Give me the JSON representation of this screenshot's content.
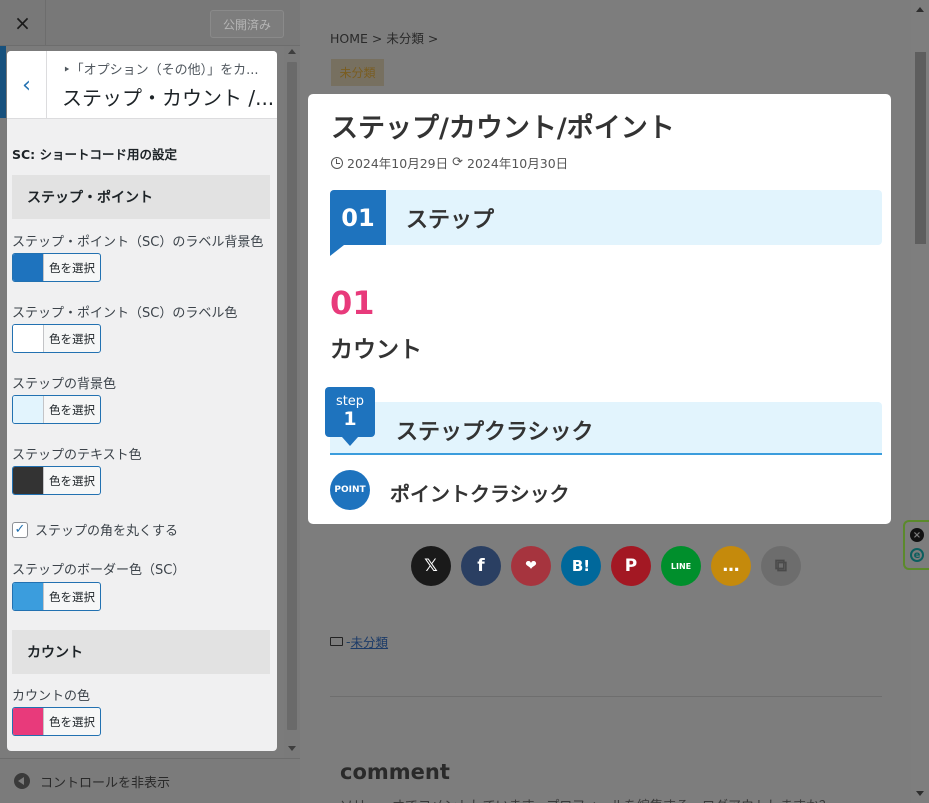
{
  "topbar": {
    "close_icon": "×",
    "publish_label": "公開済み"
  },
  "panel": {
    "back_icon": "‹",
    "breadcrumb": "‣「オプション（その他）」をカ...",
    "title": "ステップ・カウント /...",
    "shortcode_title": "SC: ショートコード用の設定",
    "section_step_point": "ステップ・ポイント",
    "section_count": "カウント",
    "fields": [
      {
        "label": "ステップ・ポイント（SC）のラベル背景色",
        "button": "色を選択",
        "color": "#1e73be"
      },
      {
        "label": "ステップ・ポイント（SC）のラベル色",
        "button": "色を選択",
        "color": "#ffffff"
      },
      {
        "label": "ステップの背景色",
        "button": "色を選択",
        "color": "#e2f4fd"
      },
      {
        "label": "ステップのテキスト色",
        "button": "色を選択",
        "color": "#333333"
      },
      {
        "label": "ステップのボーダー色（SC）",
        "button": "色を選択",
        "color": "#3b9ddd"
      },
      {
        "label": "カウントの色",
        "button": "色を選択",
        "color": "#e83a7b"
      }
    ],
    "checkbox_label": "ステップの角を丸くする",
    "checkbox_checked": true
  },
  "footer": {
    "hide_controls": "コントロールを非表示"
  },
  "preview": {
    "breadcrumb": "HOME > 未分類 >",
    "category_tag": "未分類",
    "post_title": "ステップ/カウント/ポイント",
    "published_date": "2024年10月29日",
    "updated_date": "2024年10月30日",
    "step_number": "01",
    "step_label": "ステップ",
    "count_number": "01",
    "count_label": "カウント",
    "classic_step_word": "step",
    "classic_step_number": "1",
    "classic_label": "ステップクラシック",
    "point_badge": "POINT",
    "point_label": "ポイントクラシック",
    "share_buttons": [
      {
        "name": "x",
        "glyph": "𝕏",
        "color": "#1a1a1a"
      },
      {
        "name": "facebook",
        "glyph": "f",
        "color": "#2a3f62"
      },
      {
        "name": "pocket",
        "glyph": "❤",
        "color": "#a6343e"
      },
      {
        "name": "hatena",
        "glyph": "B!",
        "color": "#00689b"
      },
      {
        "name": "pinterest",
        "glyph": "P",
        "color": "#a31823"
      },
      {
        "name": "line",
        "glyph": "LINE",
        "color": "#008f2c"
      },
      {
        "name": "comment",
        "glyph": "…",
        "color": "#c58a0c"
      },
      {
        "name": "copy",
        "glyph": "⧉",
        "color": "#6d6d6d"
      }
    ],
    "category_link": "未分類",
    "comment_heading": "comment",
    "comment_text": "ソリューオでコメントしています。プロフィールを編集する。ログアウトしますか？"
  }
}
